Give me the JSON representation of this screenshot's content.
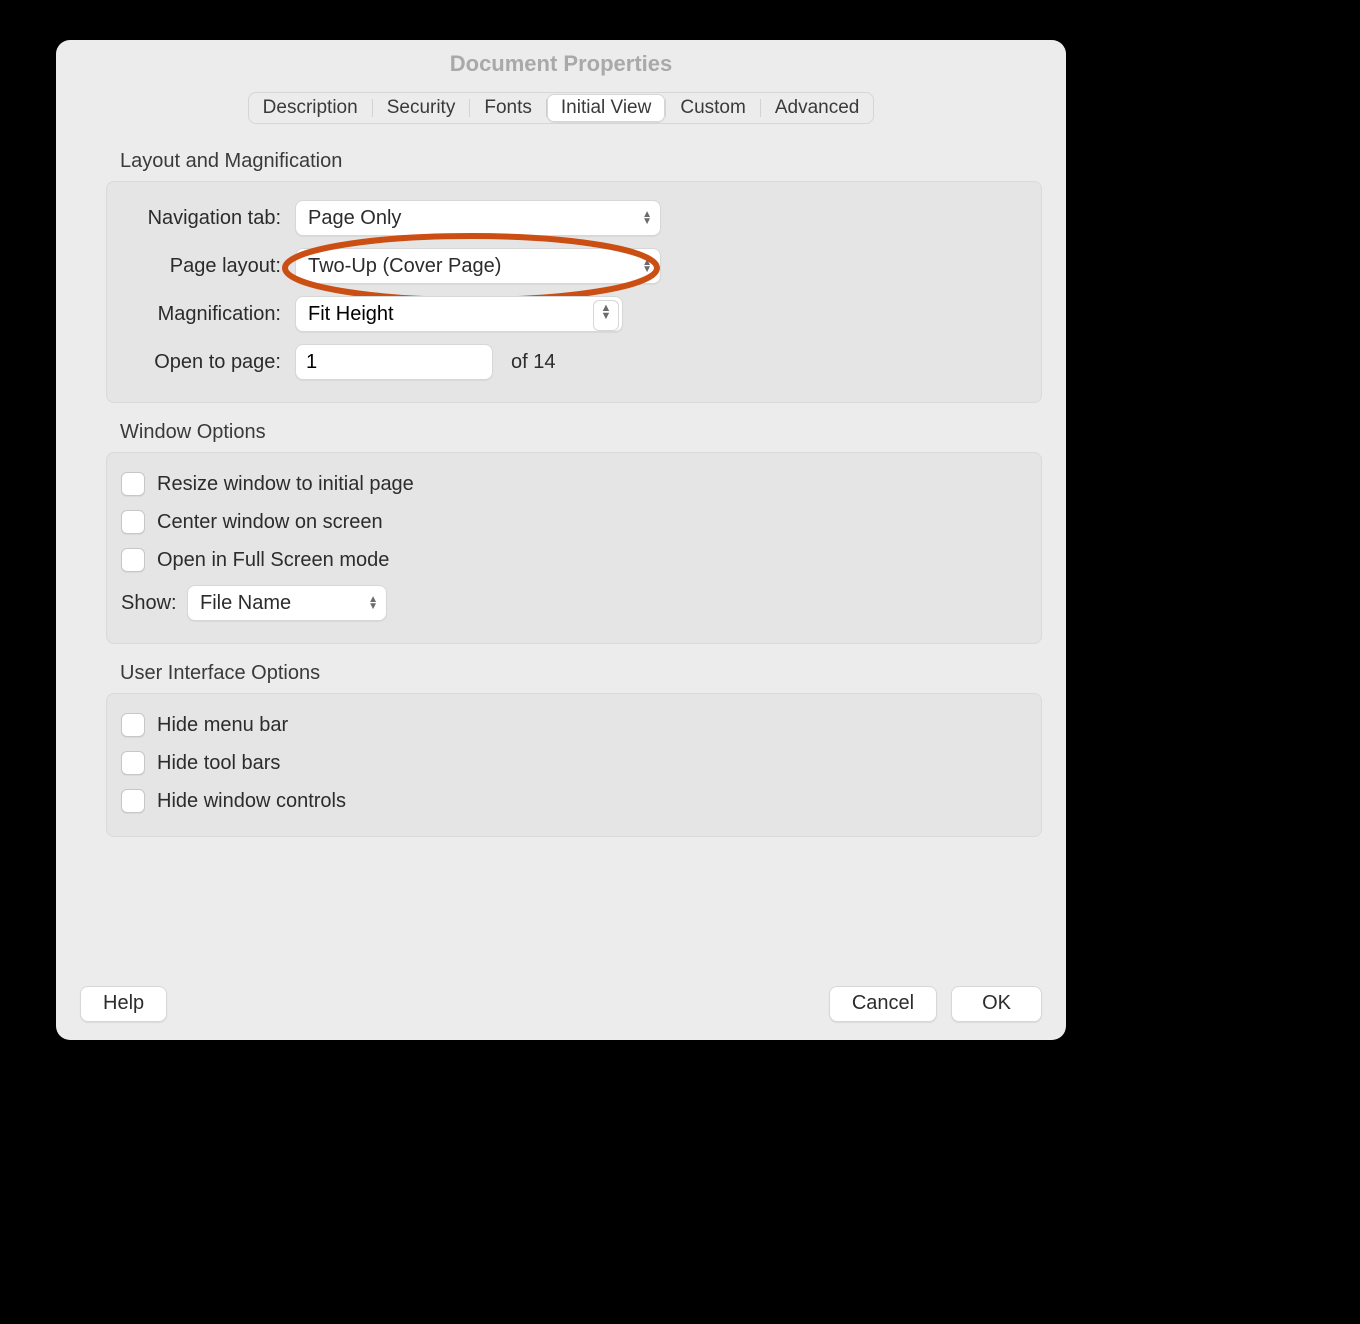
{
  "window": {
    "title": "Document Properties"
  },
  "tabs": {
    "items": [
      {
        "label": "Description"
      },
      {
        "label": "Security"
      },
      {
        "label": "Fonts"
      },
      {
        "label": "Initial View"
      },
      {
        "label": "Custom"
      },
      {
        "label": "Advanced"
      }
    ],
    "active_index": 3
  },
  "layout_mag": {
    "title": "Layout and Magnification",
    "nav_label": "Navigation tab:",
    "nav_value": "Page Only",
    "page_layout_label": "Page layout:",
    "page_layout_value": "Two-Up (Cover Page)",
    "magnification_label": "Magnification:",
    "magnification_value": "Fit Height",
    "open_to_page_label": "Open to page:",
    "open_to_page_value": "1",
    "open_to_page_suffix": "of 14"
  },
  "window_options": {
    "title": "Window Options",
    "resize": "Resize window to initial page",
    "center": "Center window on screen",
    "fullscreen": "Open in Full Screen mode",
    "show_label": "Show:",
    "show_value": "File Name"
  },
  "ui_options": {
    "title": "User Interface Options",
    "hide_menubar": "Hide menu bar",
    "hide_toolbars": "Hide tool bars",
    "hide_window_controls": "Hide window controls"
  },
  "buttons": {
    "help": "Help",
    "cancel": "Cancel",
    "ok": "OK"
  },
  "annotation": {
    "color": "#cb4e13"
  }
}
